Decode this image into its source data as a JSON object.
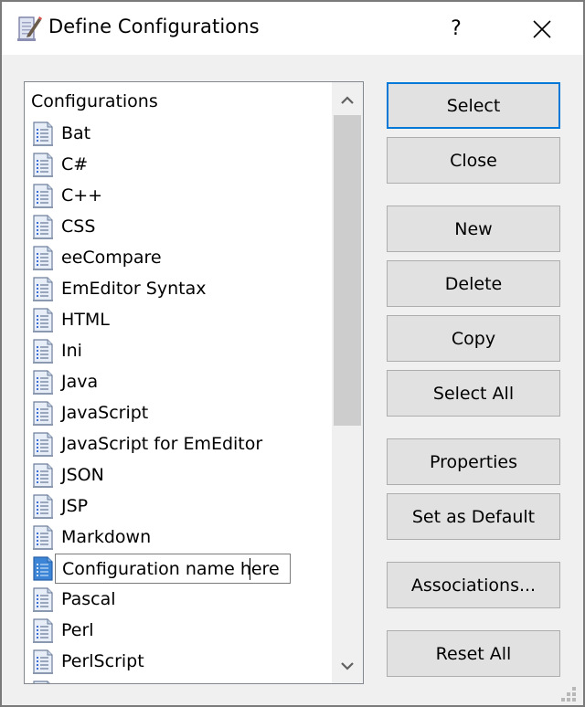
{
  "window": {
    "title": "Define Configurations",
    "title_icon": "notepad-pencil-icon",
    "help_label": "?",
    "close_icon": "close-icon"
  },
  "list": {
    "header": "Configurations",
    "items": [
      {
        "label": "Bat"
      },
      {
        "label": "C#"
      },
      {
        "label": "C++"
      },
      {
        "label": "CSS"
      },
      {
        "label": "eeCompare"
      },
      {
        "label": "EmEditor Syntax"
      },
      {
        "label": "HTML"
      },
      {
        "label": "Ini"
      },
      {
        "label": "Java"
      },
      {
        "label": "JavaScript"
      },
      {
        "label": "JavaScript for EmEditor"
      },
      {
        "label": "JSON"
      },
      {
        "label": "JSP"
      },
      {
        "label": "Markdown"
      }
    ],
    "editing_item": {
      "value": "Configuration name here",
      "selected": true
    },
    "items_after": [
      {
        "label": "Pascal"
      },
      {
        "label": "Perl"
      },
      {
        "label": "PerlScript"
      }
    ],
    "scroll_up_icon": "chevron-up-icon",
    "scroll_down_icon": "chevron-down-icon"
  },
  "buttons": {
    "select": "Select",
    "close": "Close",
    "new": "New",
    "delete": "Delete",
    "copy": "Copy",
    "select_all": "Select All",
    "properties": "Properties",
    "set_default": "Set as Default",
    "associations": "Associations...",
    "reset_all": "Reset All"
  },
  "colors": {
    "accent": "#0078d7",
    "button_face": "#e1e1e1",
    "dialog_bg": "#f0f0f0",
    "scroll_thumb": "#cdcdcd"
  }
}
